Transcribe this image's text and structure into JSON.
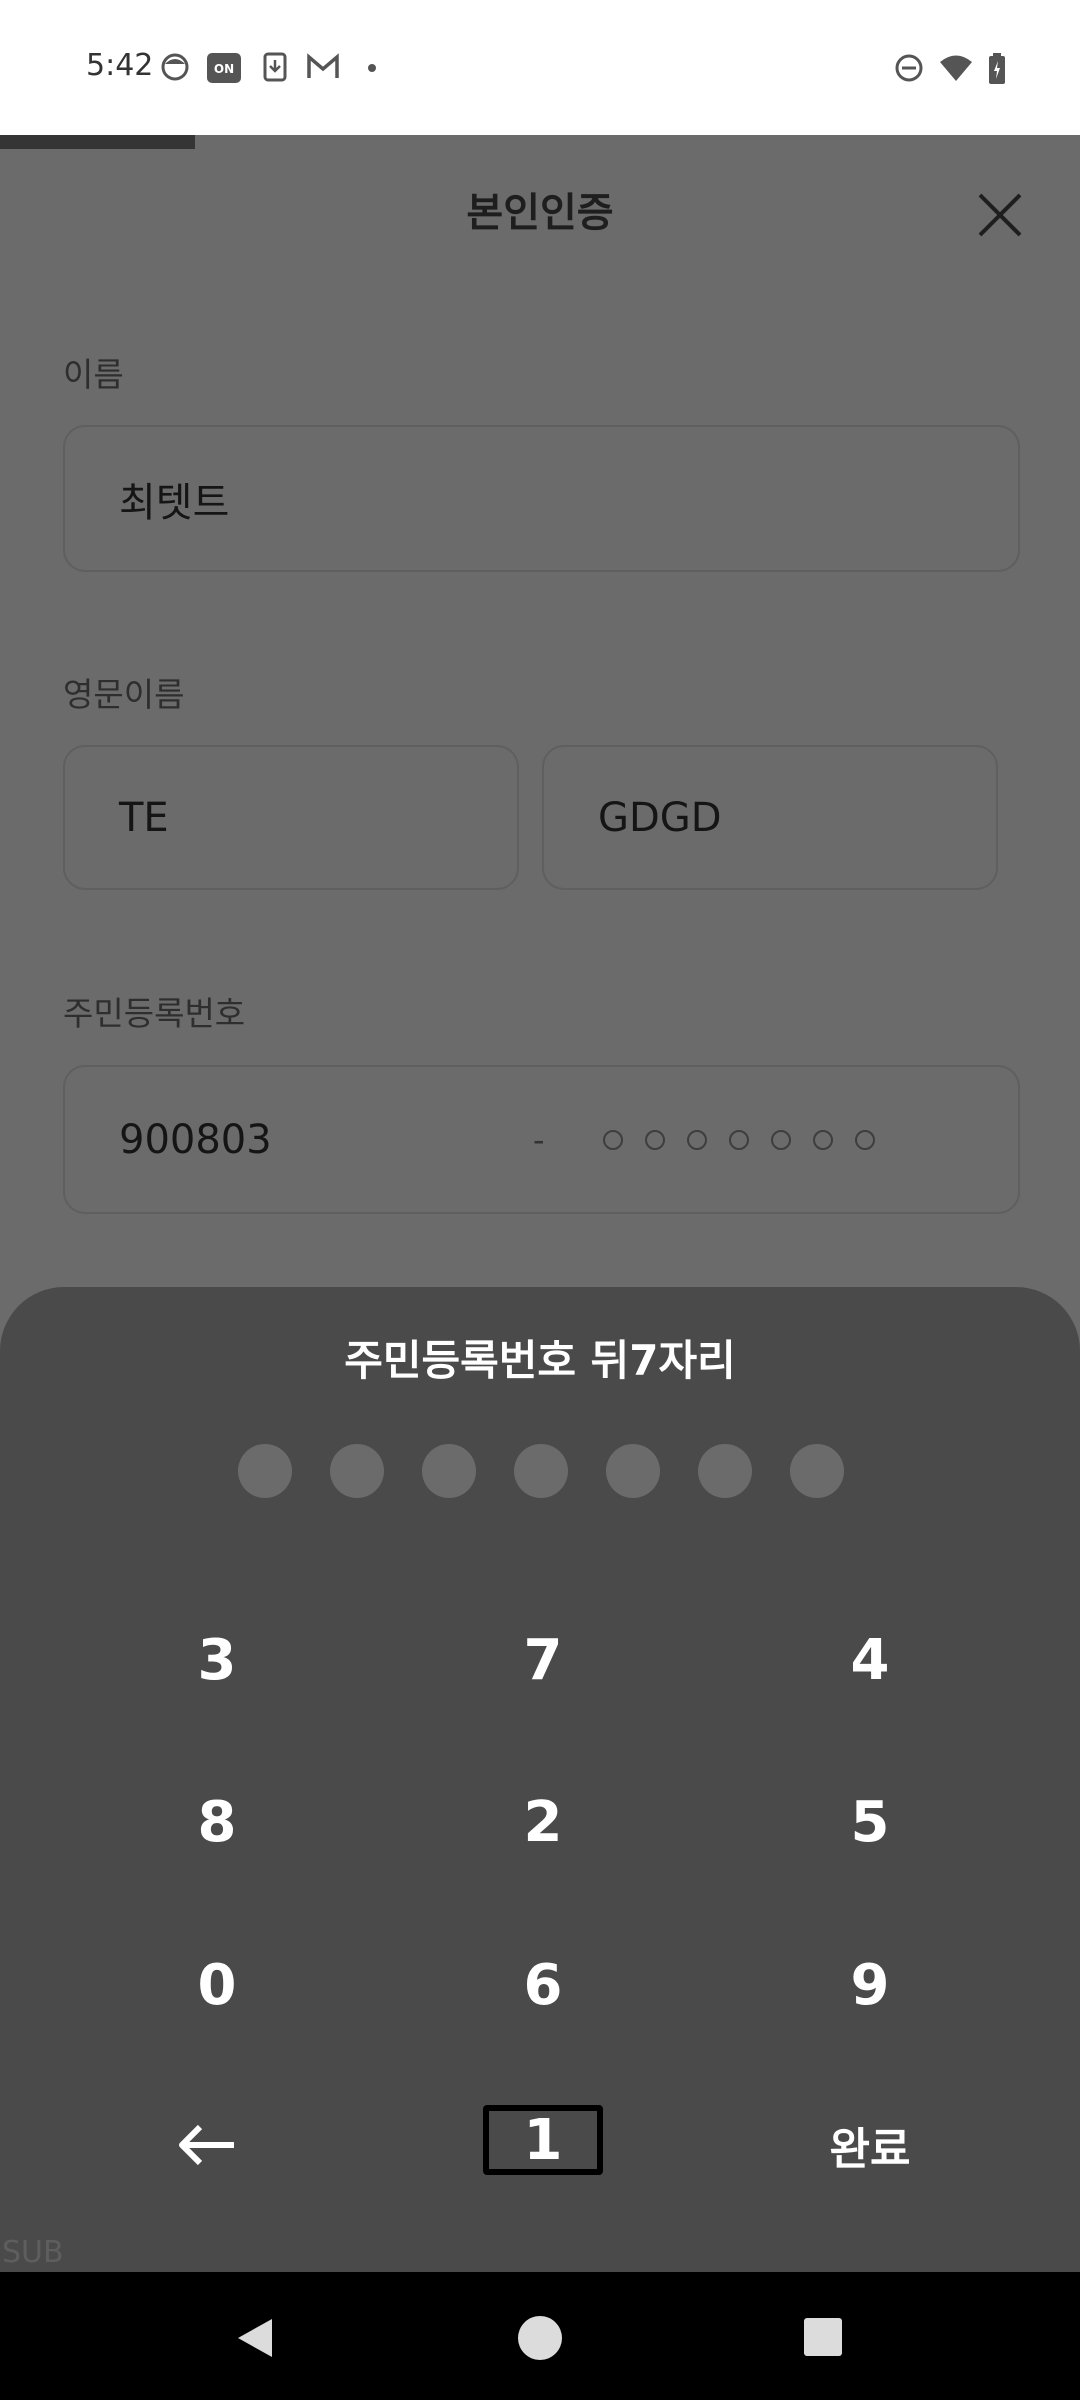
{
  "status_bar": {
    "time": "5:42",
    "left_icons": [
      "face-icon",
      "on-badge-icon",
      "download-icon",
      "gmail-icon",
      "dot-icon"
    ],
    "right_icons": [
      "dnd-icon",
      "wifi-icon",
      "battery-charging-icon"
    ]
  },
  "header": {
    "title": "본인인증",
    "close_icon": "close-icon",
    "progress_fraction": 0.18
  },
  "form": {
    "name": {
      "label": "이름",
      "value": "최텟트"
    },
    "english_name": {
      "label": "영문이름",
      "first": "TE",
      "last": "GDGD"
    },
    "rrn": {
      "label": "주민등록번호",
      "front": "900803",
      "dash": "-",
      "back_digits": 7
    }
  },
  "keypad": {
    "title": "주민등록번호 뒤7자리",
    "entered": 0,
    "length": 7,
    "rows": [
      [
        "3",
        "7",
        "4"
      ],
      [
        "8",
        "2",
        "5"
      ],
      [
        "0",
        "6",
        "9"
      ]
    ],
    "backspace_icon": "arrow-left-icon",
    "bottom_middle": "1",
    "done_label": "완료"
  },
  "sub_label": "SUB",
  "nav": [
    "back-icon",
    "home-icon",
    "recents-icon"
  ],
  "colors": {
    "overlay": "#6b6b6b",
    "sheet": "#4a4a4a",
    "pin_dot": "#6b6b6b",
    "key_text": "#ffffff"
  }
}
